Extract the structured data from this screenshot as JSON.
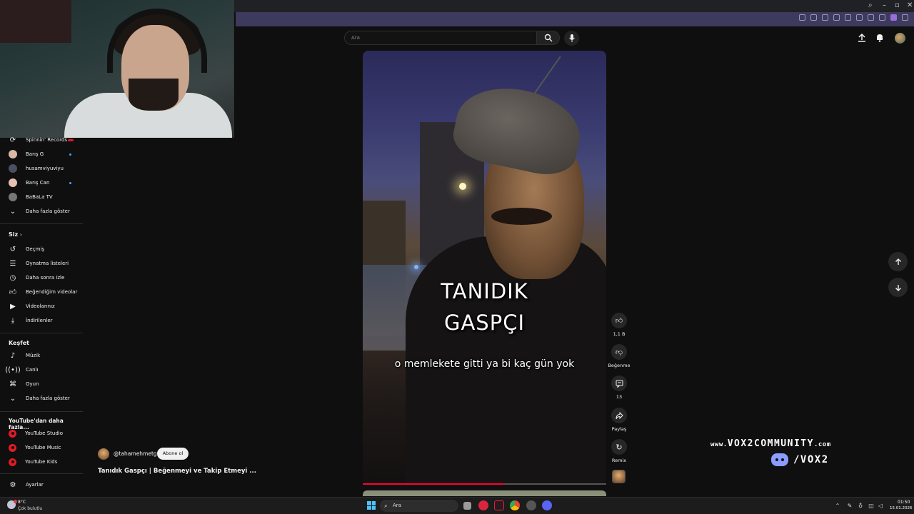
{
  "sidebar": {
    "subscriptions": [
      {
        "label": "Spinnin' Records",
        "badge": "live"
      },
      {
        "label": "Barış G",
        "dot": true
      },
      {
        "label": "husamviyuviyu",
        "dot": false
      },
      {
        "label": "Barış Can",
        "dot": true
      },
      {
        "label": "BaBaLa TV",
        "dot": false
      }
    ],
    "show_more_1": "Daha fazla göster",
    "you_heading": "Siz",
    "you_items": [
      "Geçmiş",
      "Oynatma listeleri",
      "Daha sonra izle",
      "Beğendiğim videolar",
      "Videolarınız",
      "İndirilenler"
    ],
    "explore_heading": "Keşfet",
    "explore_items": [
      "Müzik",
      "Canlı",
      "Oyun"
    ],
    "show_more_2": "Daha fazla göster",
    "more_heading": "YouTube'dan daha fazla...",
    "more_items": [
      "YouTube Studio",
      "YouTube Music",
      "YouTube Kids"
    ],
    "settings": "Ayarlar"
  },
  "header": {
    "search_placeholder": "Ara"
  },
  "video": {
    "overlay_title_1": "TANIDIK",
    "overlay_title_2": "GASPÇI",
    "subtitle": "o memlekete gitti ya bi kaç gün yok",
    "progress": 0.58,
    "channel": "@tahamehmetg",
    "subscribe_label": "Abone ol",
    "title": "Tanıdık Gaspçı | Beğenmeyi ve Takip Etmeyi ..."
  },
  "actions": {
    "like_count": "1,1 B",
    "dislike_label": "Beğenme",
    "comment_count": "13",
    "share_label": "Paylaş",
    "remix_label": "Remix"
  },
  "watermark": {
    "url_prefix": "www.",
    "url_main": "VOX2COMMUNITY",
    "url_suffix": ".com",
    "handle": "/VOX2"
  },
  "taskbar": {
    "temp": "8°C",
    "weather": "Çok bulutlu",
    "search": "Ara",
    "time": "01:50",
    "date": "15.01.2026"
  },
  "colors": {
    "background": "#0f0f0f",
    "accent_red": "#ff0033",
    "addressbar": "#3d3a5e"
  }
}
